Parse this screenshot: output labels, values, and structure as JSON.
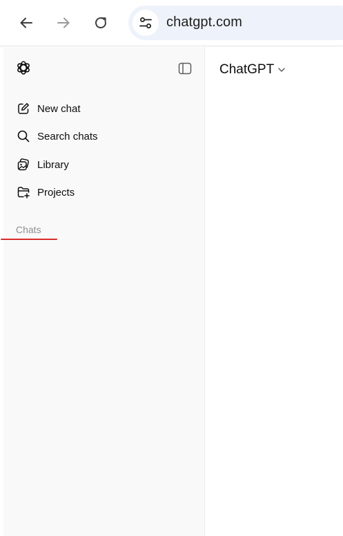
{
  "browser": {
    "url": "chatgpt.com",
    "icons": {
      "back": "arrow-left-icon",
      "forward": "arrow-right-icon",
      "reload": "reload-icon",
      "site_info": "tune-icon"
    }
  },
  "sidebar": {
    "logo": "chatgpt-logo-icon",
    "toggle": "sidebar-toggle-icon",
    "items": [
      {
        "label": "New chat",
        "icon": "edit-icon"
      },
      {
        "label": "Search chats",
        "icon": "search-icon"
      },
      {
        "label": "Library",
        "icon": "library-icon"
      },
      {
        "label": "Projects",
        "icon": "folder-plus-icon"
      }
    ],
    "chats_heading": "Chats"
  },
  "main": {
    "model_name": "ChatGPT"
  },
  "colors": {
    "omnibox_bg": "#eef2fa",
    "sidebar_bg": "#f9f9f9",
    "annotation_red": "#d92b2b",
    "muted_text": "#8f8f8f"
  }
}
